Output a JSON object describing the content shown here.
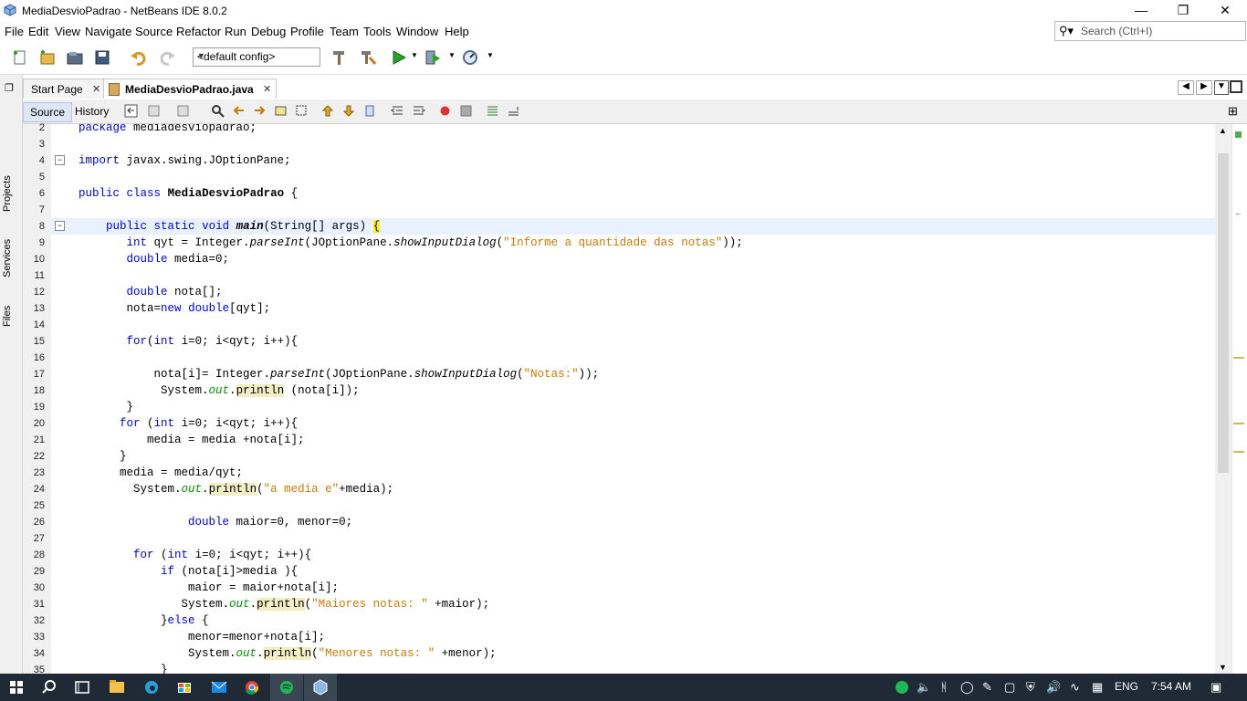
{
  "window": {
    "title": "MediaDesvioPadrao - NetBeans IDE 8.0.2"
  },
  "menu": [
    "File",
    "Edit",
    "View",
    "Navigate",
    "Source",
    "Refactor",
    "Run",
    "Debug",
    "Profile",
    "Team",
    "Tools",
    "Window",
    "Help"
  ],
  "search": {
    "placeholder": "Search (Ctrl+I)"
  },
  "toolbar": {
    "config": "<default config>"
  },
  "side_panels": [
    "Projects",
    "Services",
    "Files"
  ],
  "tabs": [
    {
      "label": "Start Page",
      "active": false
    },
    {
      "label": "MediaDesvioPadrao.java",
      "active": true
    }
  ],
  "editor_tabs": [
    "Source",
    "History"
  ],
  "code_lines": [
    {
      "n": "2",
      "t": "package mediadesviopadrao;"
    },
    {
      "n": "3",
      "t": ""
    },
    {
      "n": "4",
      "t": "import javax.swing.JOptionPane;"
    },
    {
      "n": "5",
      "t": ""
    },
    {
      "n": "6",
      "t": "public class MediaDesvioPadrao {"
    },
    {
      "n": "7",
      "t": ""
    },
    {
      "n": "8",
      "t": "    public static void main(String[] args) {"
    },
    {
      "n": "9",
      "t": "       int qyt = Integer.parseInt(JOptionPane.showInputDialog(\"Informe a quantidade das notas\"));"
    },
    {
      "n": "10",
      "t": "       double media=0;"
    },
    {
      "n": "11",
      "t": ""
    },
    {
      "n": "12",
      "t": "       double nota[];"
    },
    {
      "n": "13",
      "t": "       nota=new double[qyt];"
    },
    {
      "n": "14",
      "t": ""
    },
    {
      "n": "15",
      "t": "       for(int i=0; i<qyt; i++){"
    },
    {
      "n": "16",
      "t": ""
    },
    {
      "n": "17",
      "t": "           nota[i]= Integer.parseInt(JOptionPane.showInputDialog(\"Notas:\"));"
    },
    {
      "n": "18",
      "t": "            System.out.println (nota[i]);"
    },
    {
      "n": "19",
      "t": "       }"
    },
    {
      "n": "20",
      "t": "      for (int i=0; i<qyt; i++){"
    },
    {
      "n": "21",
      "t": "          media = media +nota[i];"
    },
    {
      "n": "22",
      "t": "      }"
    },
    {
      "n": "23",
      "t": "      media = media/qyt;"
    },
    {
      "n": "24",
      "t": "        System.out.println(\"a media e\"+media);"
    },
    {
      "n": "25",
      "t": ""
    },
    {
      "n": "26",
      "t": "                double maior=0, menor=0;"
    },
    {
      "n": "27",
      "t": ""
    },
    {
      "n": "28",
      "t": "        for (int i=0; i<qyt; i++){"
    },
    {
      "n": "29",
      "t": "            if (nota[i]>media ){"
    },
    {
      "n": "30",
      "t": "                maior = maior+nota[i];"
    },
    {
      "n": "31",
      "t": "               System.out.println(\"Maiores notas: \" +maior);"
    },
    {
      "n": "32",
      "t": "            }else {"
    },
    {
      "n": "33",
      "t": "                menor=menor+nota[i];"
    },
    {
      "n": "34",
      "t": "                System.out.println(\"Menores notas: \" +menor);"
    },
    {
      "n": "35",
      "t": "            }"
    }
  ],
  "taskbar": {
    "lang": "ENG",
    "time": "7:54 AM"
  }
}
